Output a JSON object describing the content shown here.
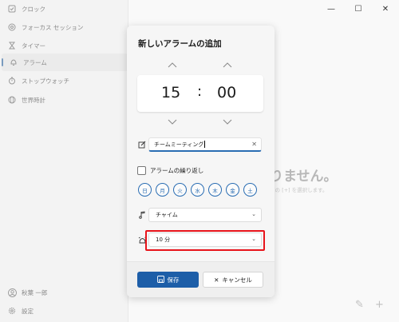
{
  "window": {
    "minimize": "—",
    "maximize": "☐",
    "close": "✕"
  },
  "sidebar": {
    "items": [
      {
        "label": "クロック",
        "icon": "clock-icon"
      },
      {
        "label": "フォーカス セッション",
        "icon": "focus-icon"
      },
      {
        "label": "タイマー",
        "icon": "hourglass-icon"
      },
      {
        "label": "アラーム",
        "icon": "bell-icon"
      },
      {
        "label": "ストップウォッチ",
        "icon": "stopwatch-icon"
      },
      {
        "label": "世界時計",
        "icon": "globe-icon"
      }
    ],
    "user": "秋葉 一郎",
    "settings": "設定"
  },
  "background": {
    "empty_title": "りません。",
    "empty_sub": "下の [+] を選択します。"
  },
  "dialog": {
    "title": "新しいアラームの追加",
    "hour": "15",
    "separator": ":",
    "minute": "00",
    "alarm_name": "チームミーティング",
    "repeat_label": "アラームの繰り返し",
    "days": [
      "日",
      "月",
      "火",
      "水",
      "木",
      "金",
      "土"
    ],
    "sound": "チャイム",
    "snooze": "10 分",
    "save_label": "保存",
    "cancel_label": "キャンセル"
  },
  "colors": {
    "accent": "#1d5ea8",
    "highlight": "#e8141b"
  }
}
